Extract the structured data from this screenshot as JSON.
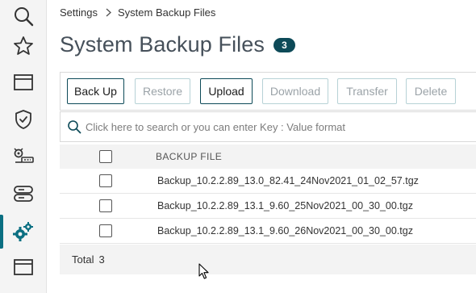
{
  "sidebar": {
    "items": [
      {
        "icon": "search-icon",
        "active": false
      },
      {
        "icon": "star-icon",
        "active": false
      },
      {
        "icon": "window-icon",
        "active": false
      },
      {
        "icon": "shield-check-icon",
        "active": false
      },
      {
        "icon": "network-tools-icon",
        "active": false
      },
      {
        "icon": "server-stack-icon",
        "active": false
      },
      {
        "icon": "gears-icon",
        "active": true
      },
      {
        "icon": "window-icon",
        "active": false
      }
    ],
    "accent_color": "#0b6f82"
  },
  "breadcrumb": {
    "root": "Settings",
    "current": "System Backup Files"
  },
  "header": {
    "title": "System Backup Files",
    "count": "3"
  },
  "toolbar": {
    "back_up": "Back Up",
    "restore": "Restore",
    "upload": "Upload",
    "download": "Download",
    "transfer": "Transfer",
    "delete": "Delete"
  },
  "search": {
    "placeholder": "Click here to search or you can enter Key : Value format"
  },
  "table": {
    "column": "BACKUP FILE",
    "rows": [
      "Backup_10.2.2.89_13.0_82.41_24Nov2021_01_02_57.tgz",
      "Backup_10.2.2.89_13.1_9.60_25Nov2021_00_30_00.tgz",
      "Backup_10.2.2.89_13.1_9.60_26Nov2021_00_30_00.tgz"
    ]
  },
  "footer": {
    "total_label": "Total",
    "total_count": "3"
  },
  "colors": {
    "badge": "#0d4a58",
    "button_border": "#0d4a58",
    "disabled_border": "#b7d2d6"
  }
}
